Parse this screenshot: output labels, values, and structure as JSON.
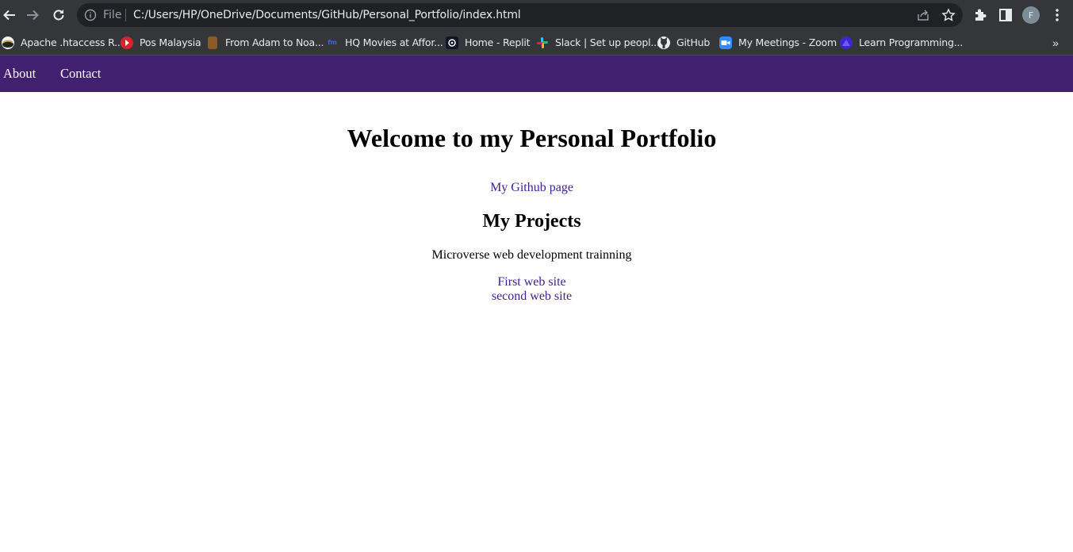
{
  "browser": {
    "omnibox_scheme": "File",
    "url": "C:/Users/HP/OneDrive/Documents/GitHub/Personal_Portfolio/index.html",
    "profile_initial": "F",
    "bookmarks": [
      {
        "label": "Apache .htaccess R...",
        "icon": "apache-icon"
      },
      {
        "label": "Pos Malaysia",
        "icon": "pos-icon"
      },
      {
        "label": "From Adam to Noa...",
        "icon": "book-icon"
      },
      {
        "label": "HQ Movies at Affor...",
        "icon": "movies-icon"
      },
      {
        "label": "Home - Replit",
        "icon": "replit-icon"
      },
      {
        "label": "Slack | Set up peopl...",
        "icon": "slack-icon"
      },
      {
        "label": "GitHub",
        "icon": "github-icon"
      },
      {
        "label": "My Meetings - Zoom",
        "icon": "zoom-icon"
      },
      {
        "label": "Learn Programming...",
        "icon": "learn-icon"
      }
    ],
    "more_label": "»"
  },
  "site": {
    "nav": {
      "about": "About",
      "contact": "Contact"
    },
    "title": "Welcome to my Personal Portfolio",
    "github_link": "My Github page",
    "projects_heading": "My Projects",
    "projects_desc": "Microverse web development trainning",
    "projects": [
      "First web site",
      "second web site"
    ]
  },
  "colors": {
    "nav_bg": "#41206f",
    "link": "#41209a",
    "chrome_bg": "#35363a",
    "omnibox_bg": "#202124"
  }
}
